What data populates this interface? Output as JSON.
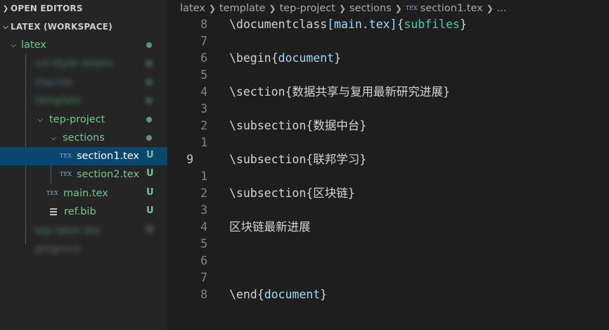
{
  "explorer": {
    "open_editors_title": "OPEN EDITORS",
    "workspace_title": "LATEX (WORKSPACE)",
    "root_folder": "latex",
    "blurred_items": [
      "csl-style-zotero",
      "macros",
      "template"
    ],
    "project_folder": "tep-project",
    "sections_folder": "sections",
    "files": [
      {
        "name": "section1.tex",
        "badge": "U",
        "icon": "tex-file-icon",
        "selected": true
      },
      {
        "name": "section2.tex",
        "badge": "U",
        "icon": "tex-file-icon",
        "selected": false
      },
      {
        "name": "main.tex",
        "badge": "U",
        "icon": "tex-file-icon",
        "selected": false
      },
      {
        "name": "ref.bib",
        "badge": "U",
        "icon": "bib-file-icon",
        "selected": false
      }
    ],
    "blurred_bottom": [
      "tep-latex.tex",
      "gitignore"
    ],
    "tex_icon_text": "TEX",
    "colors": {
      "modified_dot": "#73c991",
      "untracked": "#73c991",
      "folder_text": "#73c991",
      "selection": "#094771"
    }
  },
  "breadcrumb": {
    "items": [
      "latex",
      "template",
      "tep-project",
      "sections"
    ],
    "file": "section1.tex",
    "ellipsis": "..."
  },
  "editor": {
    "lines": [
      {
        "num": "8",
        "cmd": "\\documentclass",
        "opt": "[main.tex]",
        "arg": "{subfiles}"
      },
      {
        "num": "7",
        "cmd": "",
        "opt": "",
        "arg": ""
      },
      {
        "num": "6",
        "cmd": "\\begin",
        "opt": "",
        "arg": "{document}"
      },
      {
        "num": "5",
        "cmd": "",
        "opt": "",
        "arg": ""
      },
      {
        "num": "4",
        "cmd": "\\section",
        "opt": "",
        "arg": "{数据共享与复用最新研究进展}"
      },
      {
        "num": "3",
        "cmd": "",
        "opt": "",
        "arg": ""
      },
      {
        "num": "2",
        "cmd": "\\subsection",
        "opt": "",
        "arg": "{数据中台}"
      },
      {
        "num": "1",
        "cmd": "",
        "opt": "",
        "arg": ""
      },
      {
        "num": "9",
        "cmd": "\\subsection",
        "opt": "",
        "arg": "{联邦学习}",
        "current": true
      },
      {
        "num": "1",
        "cmd": "",
        "opt": "",
        "arg": ""
      },
      {
        "num": "2",
        "cmd": "\\subsection",
        "opt": "",
        "arg": "{区块链}"
      },
      {
        "num": "3",
        "cmd": "",
        "opt": "",
        "arg": ""
      },
      {
        "num": "4",
        "cmd": "区块链最新进展",
        "opt": "",
        "arg": "",
        "plain": true
      },
      {
        "num": "5",
        "cmd": "",
        "opt": "",
        "arg": ""
      },
      {
        "num": "6",
        "cmd": "",
        "opt": "",
        "arg": ""
      },
      {
        "num": "7",
        "cmd": "",
        "opt": "",
        "arg": ""
      },
      {
        "num": "8",
        "cmd": "\\end",
        "opt": "",
        "arg": "{document}"
      }
    ]
  }
}
